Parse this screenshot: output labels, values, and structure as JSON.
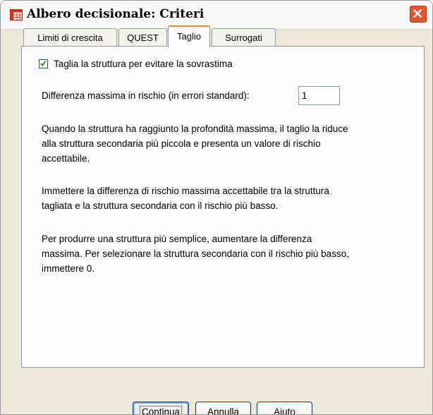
{
  "window": {
    "title": "Albero decisionale: Criteri"
  },
  "tabs": [
    {
      "label": "Limiti di crescita",
      "active": false
    },
    {
      "label": "QUEST",
      "active": false
    },
    {
      "label": "Taglio",
      "active": true
    },
    {
      "label": "Surrogati",
      "active": false
    }
  ],
  "prune": {
    "checkbox_label": "Taglia la struttura per evitare la sovrastima",
    "checked": true
  },
  "max_diff": {
    "label": "Differenza massima in rischio (in errori standard):",
    "value": "1"
  },
  "paragraphs": [
    [
      "Quando la struttura ha raggiunto la profondità massima, il taglio la riduce",
      "alla struttura secondaria più piccola e presenta un valore di rischio",
      "accettabile."
    ],
    [
      "Immettere la differenza di rischio massima accettabile tra la struttura",
      "tagliata e la struttura secondaria con il rischio più basso."
    ],
    [
      "Per produrre una struttura più semplice, aumentare la differenza",
      "massima. Per selezionare la struttura secondaria con il rischio più basso,",
      "immettere 0."
    ]
  ],
  "buttons": {
    "continue": "Continua",
    "cancel": "Annulla",
    "help": "Aiuto"
  },
  "icons": {
    "app": "tree-grid-icon",
    "close": "close-icon",
    "check": "checkmark-icon"
  }
}
